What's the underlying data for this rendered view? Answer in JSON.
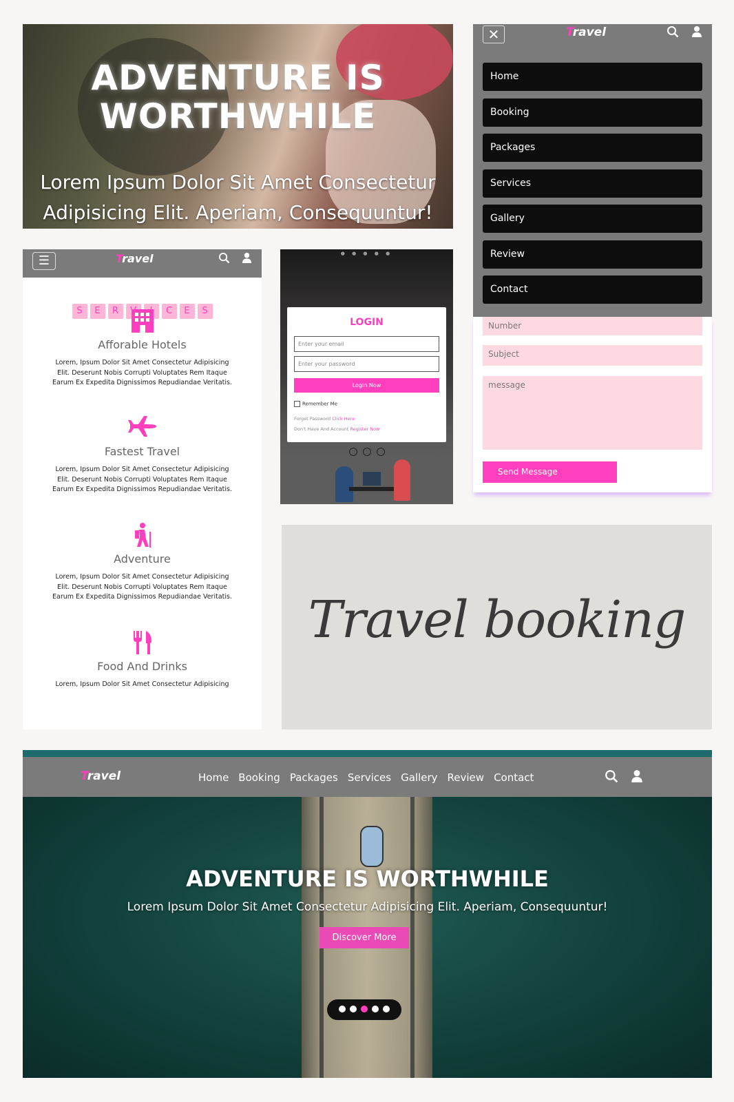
{
  "hero_mobile": {
    "title": "ADVENTURE IS WORTHWHILE",
    "subtitle": "Lorem Ipsum Dolor Sit Amet Consectetur Adipisicing Elit. Aperiam, Consequuntur!"
  },
  "brand": {
    "logo_first": "T",
    "logo_rest": "ravel",
    "accent_color": "#ff3fbd",
    "nav_bg": "#7b7b7b"
  },
  "mobile_menu": {
    "close_icon": "✕",
    "items": [
      "Home",
      "Booking",
      "Packages",
      "Services",
      "Gallery",
      "Review",
      "Contact"
    ]
  },
  "contact_form": {
    "number_placeholder": "Number",
    "subject_placeholder": "Subject",
    "message_placeholder": "message",
    "send_label": "Send Message"
  },
  "services": {
    "heading_letters": [
      "S",
      "E",
      "R",
      "V",
      "I",
      "C",
      "E",
      "S"
    ],
    "items": [
      {
        "icon": "building-icon",
        "title": "Afforable Hotels",
        "desc": "Lorem, Ipsum Dolor Sit Amet Consectetur Adipisicing Elit. Deserunt Nobis Corrupti Voluptates Rem Itaque Earum Ex Expedita Dignissimos Repudiandae Veritatis."
      },
      {
        "icon": "plane-icon",
        "title": "Fastest Travel",
        "desc": "Lorem, Ipsum Dolor Sit Amet Consectetur Adipisicing Elit. Deserunt Nobis Corrupti Voluptates Rem Itaque Earum Ex Expedita Dignissimos Repudiandae Veritatis."
      },
      {
        "icon": "hiker-icon",
        "title": "Adventure",
        "desc": "Lorem, Ipsum Dolor Sit Amet Consectetur Adipisicing Elit. Deserunt Nobis Corrupti Voluptates Rem Itaque Earum Ex Expedita Dignissimos Repudiandae Veritatis."
      },
      {
        "icon": "utensils-icon",
        "title": "Food And Drinks",
        "desc": "Lorem, Ipsum Dolor Sit Amet Consectetur Adipisicing"
      }
    ]
  },
  "login": {
    "title": "LOGIN",
    "email_placeholder": "Enter your email",
    "password_placeholder": "Enter your password",
    "button_label": "Login Now",
    "remember_label": "Remember Me",
    "forgot_text": "Forget Password",
    "forgot_link": "Click Here",
    "register_text": "Don't Have And Account",
    "register_link": "Register Now"
  },
  "script_title": "Travel booking",
  "desktop": {
    "nav_links": [
      "Home",
      "Booking",
      "Packages",
      "Services",
      "Gallery",
      "Review",
      "Contact"
    ],
    "title": "ADVENTURE IS WORTHWHILE",
    "subtitle": "Lorem Ipsum Dolor Sit Amet Consectetur Adipisicing Elit. Aperiam, Consequuntur!",
    "button_label": "Discover More",
    "slides_total": 5,
    "active_slide": 3
  }
}
